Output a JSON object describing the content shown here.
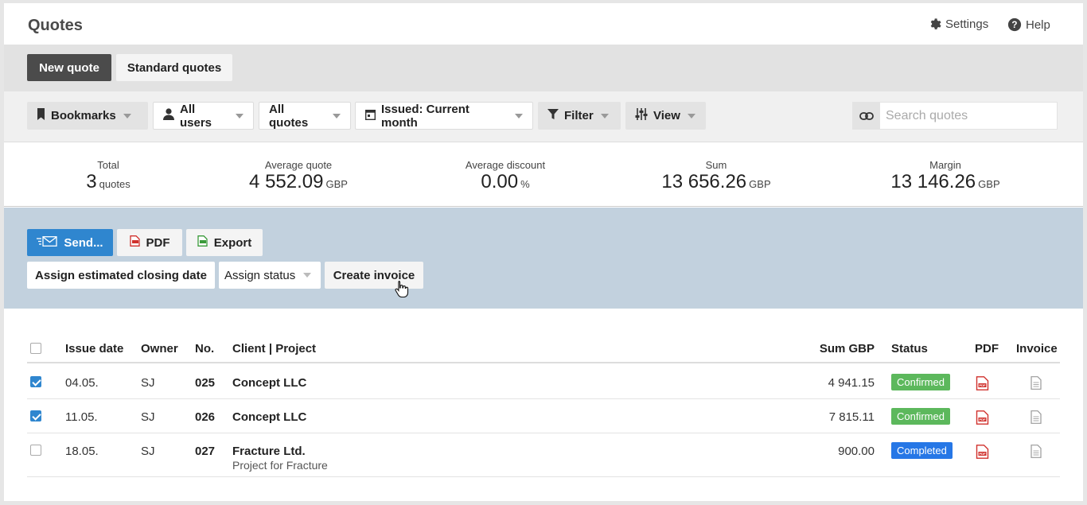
{
  "header": {
    "title": "Quotes",
    "settings_label": "Settings",
    "help_label": "Help"
  },
  "type_tabs": {
    "new_quote": "New quote",
    "standard_quotes": "Standard quotes"
  },
  "filters": {
    "bookmarks": "Bookmarks",
    "all_users": "All users",
    "all_quotes": "All quotes",
    "issued": "Issued: Current month",
    "filter": "Filter",
    "view": "View",
    "search_placeholder": "Search quotes"
  },
  "stats": {
    "total": {
      "label": "Total",
      "value": "3",
      "unit": "quotes"
    },
    "average_quote": {
      "label": "Average quote",
      "value": "4 552.09",
      "unit": "GBP"
    },
    "average_discount": {
      "label": "Average discount",
      "value": "0.00",
      "unit": "%"
    },
    "sum": {
      "label": "Sum",
      "value": "13 656.26",
      "unit": "GBP"
    },
    "margin": {
      "label": "Margin",
      "value": "13 146.26",
      "unit": "GBP"
    }
  },
  "actions": {
    "send": "Send...",
    "pdf": "PDF",
    "export": "Export",
    "assign_closing_date": "Assign estimated closing date",
    "assign_status": "Assign status",
    "create_invoice": "Create invoice"
  },
  "table": {
    "columns": {
      "issue_date": "Issue date",
      "owner": "Owner",
      "no": "No.",
      "client_project": "Client | Project",
      "sum": "Sum GBP",
      "status": "Status",
      "pdf": "PDF",
      "invoice": "Invoice"
    },
    "rows": [
      {
        "checked": true,
        "date": "04.05.",
        "owner": "SJ",
        "no": "025",
        "client": "Concept LLC",
        "project": "",
        "sum": "4 941.15",
        "status": "Confirmed"
      },
      {
        "checked": true,
        "date": "11.05.",
        "owner": "SJ",
        "no": "026",
        "client": "Concept LLC",
        "project": "",
        "sum": "7 815.11",
        "status": "Confirmed"
      },
      {
        "checked": false,
        "date": "18.05.",
        "owner": "SJ",
        "no": "027",
        "client": "Fracture Ltd.",
        "project": "Project for Fracture",
        "sum": "900.00",
        "status": "Completed"
      }
    ]
  },
  "colors": {
    "primary": "#2f86cf",
    "confirmed": "#5cb85c",
    "completed": "#2677e6",
    "action_bg": "#c2d1de",
    "pdf_red": "#d0312d"
  }
}
